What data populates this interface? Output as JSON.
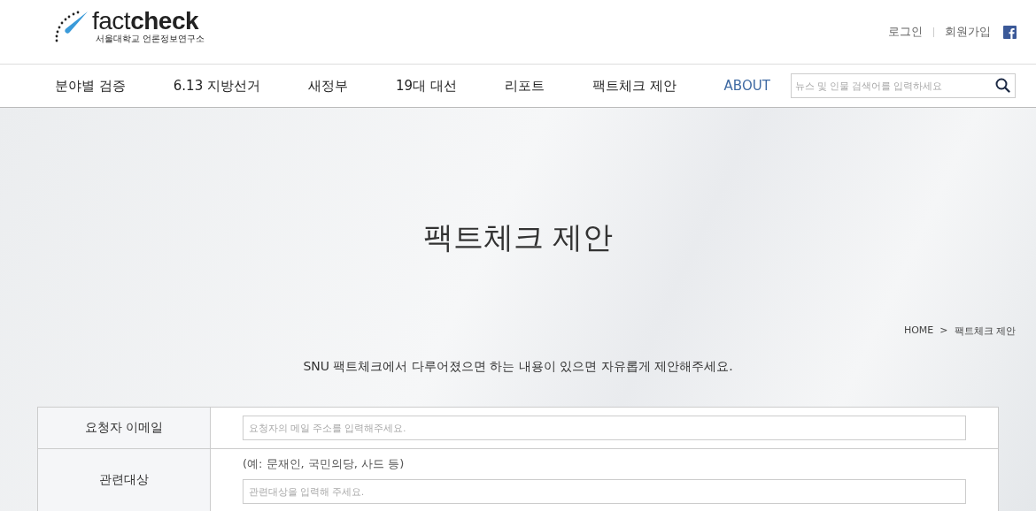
{
  "logo": {
    "name": "factcheck",
    "subtitle": "서울대학교 언론정보연구소"
  },
  "top_links": [
    "로그인",
    "회원가입"
  ],
  "nav": [
    {
      "label": "분야별 검증",
      "selected": false
    },
    {
      "label": "6.13 지방선거",
      "selected": false
    },
    {
      "label": "새정부",
      "selected": false
    },
    {
      "label": "19대 대선",
      "selected": false
    },
    {
      "label": "리포트",
      "selected": false
    },
    {
      "label": "팩트체크 제안",
      "selected": false
    },
    {
      "label": "ABOUT",
      "selected": true
    }
  ],
  "search": {
    "placeholder": "뉴스 및 인물 검색어를 입력하세요"
  },
  "page_title": "팩트체크 제안",
  "breadcrumb": [
    "HOME",
    ">",
    "팩트체크 제안"
  ],
  "intro": "SNU 팩트체크에서 다루어졌으면 하는 내용이 있으면 자유롭게 제안해주세요.",
  "form_rows": [
    {
      "label": "요청자 이메일",
      "placeholder": "요청자의 메일 주소를 입력해주세요."
    },
    {
      "label": "관련대상",
      "hint": "(예: 문재인, 국민의당, 사드 등)",
      "placeholder": "관련대상을 입력해 주세요."
    }
  ]
}
